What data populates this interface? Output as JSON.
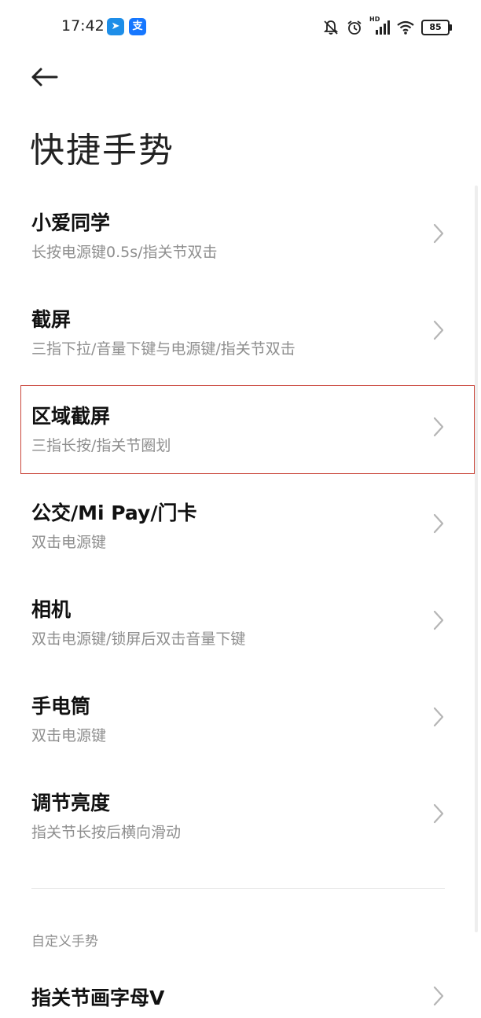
{
  "status_bar": {
    "time": "17:42",
    "app_icons": [
      {
        "name": "paper-plane-icon",
        "glyph": "➤"
      },
      {
        "name": "alipay-icon",
        "glyph": "支"
      }
    ],
    "battery_level": "85",
    "hd_label": "HD"
  },
  "header": {
    "title": "快捷手势"
  },
  "items": [
    {
      "title": "小爱同学",
      "subtitle": "长按电源键0.5s/指关节双击"
    },
    {
      "title": "截屏",
      "subtitle": "三指下拉/音量下键与电源键/指关节双击"
    },
    {
      "title": "区域截屏",
      "subtitle": "三指长按/指关节圈划"
    },
    {
      "title": "公交/Mi Pay/门卡",
      "subtitle": "双击电源键"
    },
    {
      "title": "相机",
      "subtitle": "双击电源键/锁屏后双击音量下键"
    },
    {
      "title": "手电筒",
      "subtitle": "双击电源键"
    },
    {
      "title": "调节亮度",
      "subtitle": "指关节长按后横向滑动"
    }
  ],
  "custom_section": {
    "label": "自定义手势",
    "items": [
      {
        "title": "指关节画字母V"
      }
    ]
  },
  "colors": {
    "highlight_border": "#c9453a",
    "subtitle": "#8e8e8e",
    "chevron": "#b5b5b5"
  }
}
